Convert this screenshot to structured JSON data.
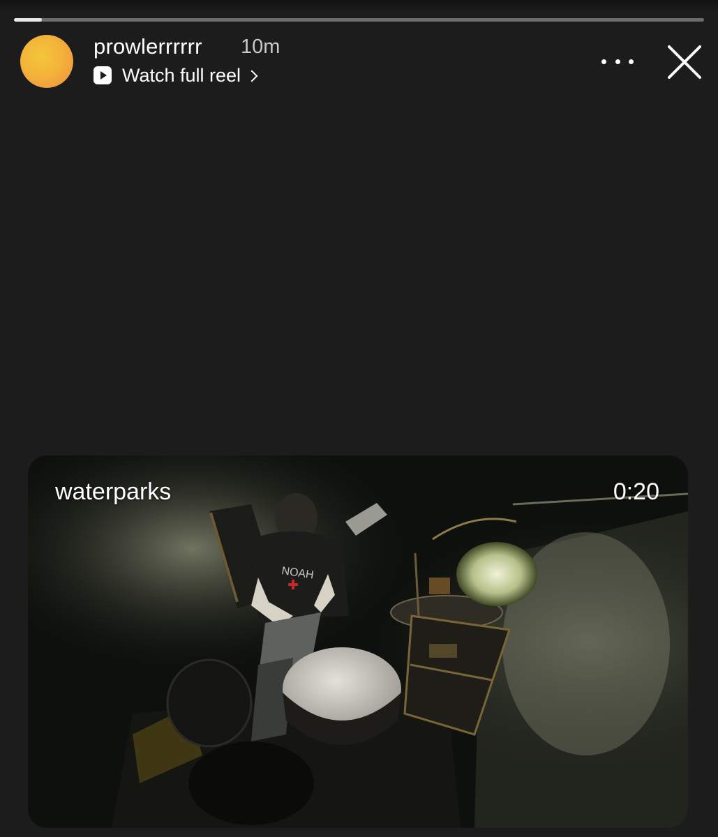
{
  "story": {
    "progress_fraction": 0.04,
    "username": "prowlerrrrrr",
    "time_ago": "10m",
    "watch_link_label": "Watch full reel",
    "icons": {
      "reel": "reel-play-icon",
      "chevron": "chevron-right-icon",
      "more": "more-options-icon",
      "close": "close-icon"
    }
  },
  "reel_card": {
    "title": "waterparks",
    "duration": "0:20",
    "thumbnail": "video-thumbnail"
  },
  "colors": {
    "background": "#1c1c1c",
    "avatar_gradient_start": "#f5c53a",
    "avatar_gradient_end": "#ee8a48"
  }
}
